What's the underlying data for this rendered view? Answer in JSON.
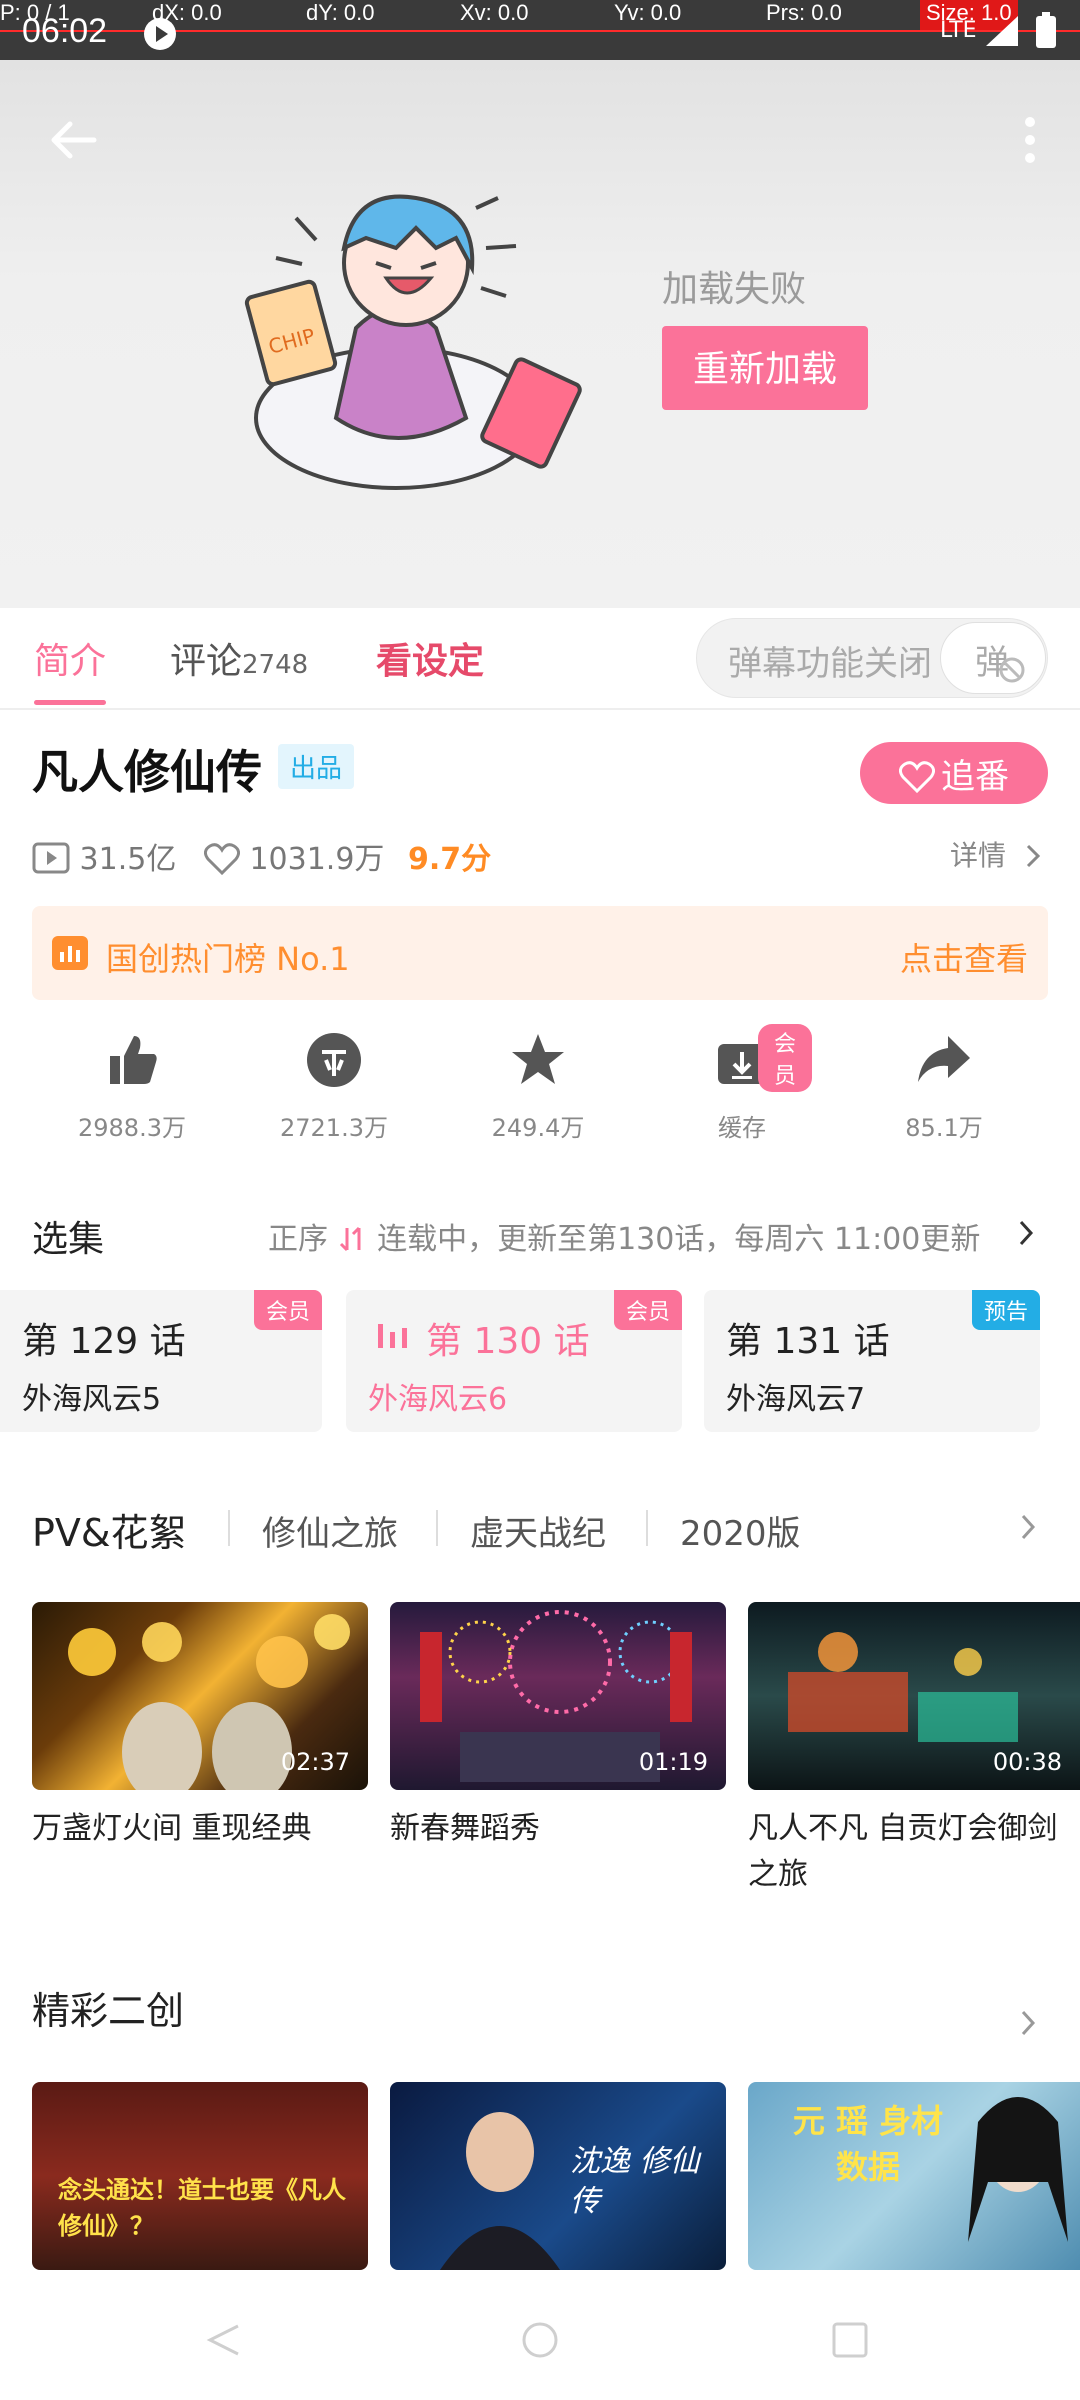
{
  "status_bar": {
    "time": "06:02",
    "debug": [
      "P: 0 / 1",
      "dX: 0.0",
      "dY: 0.0",
      "Xv: 0.0",
      "Yv: 0.0",
      "Prs: 0.0",
      "Size: 1.0"
    ],
    "network": "LTE"
  },
  "hero": {
    "fail_text": "加载失败",
    "reload_label": "重新加载"
  },
  "tabs": {
    "intro": "简介",
    "comments": "评论",
    "comments_count": "2748",
    "settings": "看设定",
    "danmaku_text": "弹幕功能关闭",
    "danmaku_icon_char": "弹"
  },
  "info": {
    "title": "凡人修仙传",
    "badge": "出品",
    "follow_label": "追番",
    "views": "31.5亿",
    "likes": "1031.9万",
    "score": "9.7分",
    "detail_label": "详情"
  },
  "rank": {
    "text": "国创热门榜 No.1",
    "link": "点击查看"
  },
  "actions": [
    {
      "label": "2988.3万",
      "icon": "thumbs-up-icon"
    },
    {
      "label": "2721.3万",
      "icon": "coin-icon"
    },
    {
      "label": "249.4万",
      "icon": "star-icon"
    },
    {
      "label": "缓存",
      "icon": "download-icon",
      "tag": "会员"
    },
    {
      "label": "85.1万",
      "icon": "share-icon"
    }
  ],
  "episodes": {
    "title": "选集",
    "order": "正序",
    "info": "连载中，更新至第130话，每周六 11:00更新",
    "items": [
      {
        "num": "第 129 话",
        "name": "外海风云5",
        "tag": "会员"
      },
      {
        "num": "第 130 话",
        "name": "外海风云6",
        "tag": "会员"
      },
      {
        "num": "第 131 话",
        "name": "外海风云7",
        "tag": "预告"
      }
    ]
  },
  "pv": {
    "title": "PV&花絮",
    "tabs": [
      "修仙之旅",
      "虚天战纪",
      "2020版"
    ],
    "videos": [
      {
        "duration": "02:37",
        "caption": "万盏灯火间 重现经典"
      },
      {
        "duration": "01:19",
        "caption": "新春舞蹈秀"
      },
      {
        "duration": "00:38",
        "caption": "凡人不凡 自贡灯会御剑之旅"
      }
    ]
  },
  "creations": {
    "title": "精彩二创",
    "thumbs": [
      {
        "text": "念头通达！道士也要《凡人修仙》？"
      },
      {
        "text": "沈逸 修仙传"
      },
      {
        "text": "元 瑶 身材数据"
      }
    ]
  },
  "colors": {
    "accent": "#fb7299",
    "orange": "#ff8e2f",
    "blue": "#23ade5"
  }
}
